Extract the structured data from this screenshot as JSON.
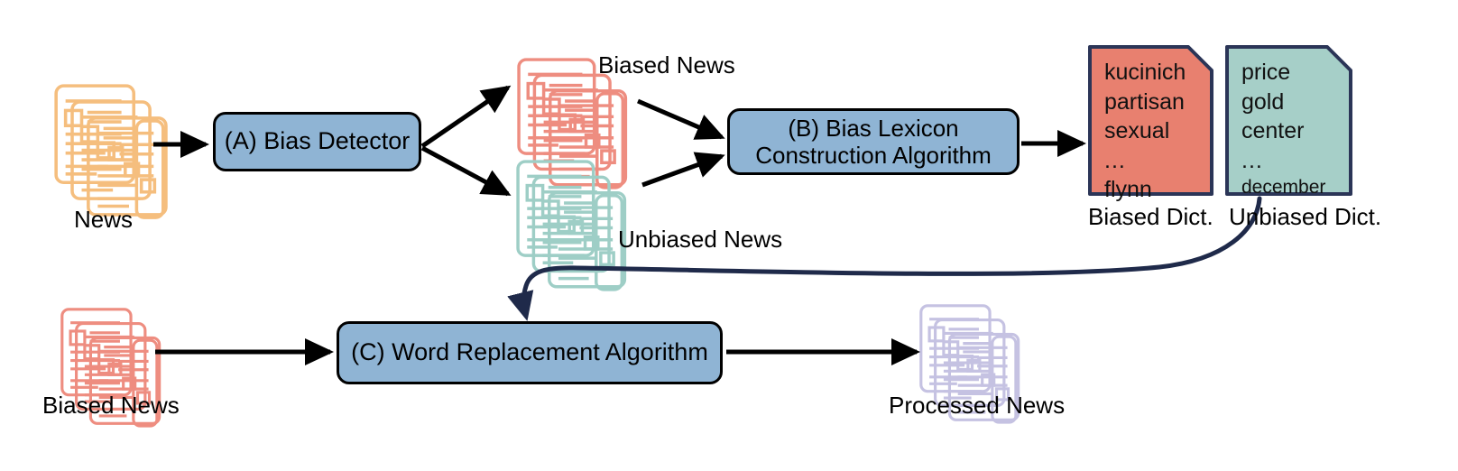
{
  "figure": {
    "type": "pipeline-diagram",
    "background": "#ffffff"
  },
  "palette": {
    "process_box_fill": "#8FB4D4",
    "process_box_stroke": "#000000",
    "news_orange": "#F5BE7E",
    "biased_red": "#EE8D80",
    "unbiased_teal": "#9ECEC6",
    "processed_purple": "#C5C2E2",
    "dict_biased_fill": "#E8806F",
    "dict_unbiased_fill": "#A6CFC8",
    "dict_stroke": "#2B3557",
    "curved_arrow": "#1F2A4A",
    "arrow_black": "#000000"
  },
  "nodes": {
    "news_stack": {
      "label": "News",
      "icon": "document-stack-icon",
      "color": "#F5BE7E"
    },
    "box_a": {
      "label": "(A) Bias Detector"
    },
    "biased_news_stack": {
      "label": "Biased News",
      "icon": "document-stack-icon",
      "color": "#EE8D80"
    },
    "unbiased_news_stack": {
      "label": "Unbiased News",
      "icon": "document-stack-icon",
      "color": "#9ECEC6"
    },
    "box_b": {
      "line1": "(B) Bias Lexicon",
      "line2": "Construction Algorithm"
    },
    "biased_dict": {
      "label": "Biased Dict.",
      "words": [
        "kucinich",
        "partisan",
        "sexual",
        "...",
        "flynn"
      ]
    },
    "unbiased_dict": {
      "label": "Unbiased Dict.",
      "words": [
        "price",
        "gold",
        "center",
        "...",
        "december"
      ]
    },
    "biased_news_stack_2": {
      "label": "Biased News",
      "icon": "document-stack-icon",
      "color": "#EE8D80"
    },
    "box_c": {
      "label": "(C) Word Replacement Algorithm"
    },
    "processed_news_stack": {
      "label": "Processed News",
      "icon": "document-stack-icon",
      "color": "#C5C2E2"
    }
  },
  "edges": [
    {
      "from": "news_stack",
      "to": "box_a",
      "style": "straight-arrow"
    },
    {
      "from": "box_a",
      "to": "biased_news_stack",
      "style": "diagonal-arrow-up"
    },
    {
      "from": "box_a",
      "to": "unbiased_news_stack",
      "style": "diagonal-arrow-down"
    },
    {
      "from": "biased_news_stack",
      "to": "box_b",
      "style": "diagonal-arrow-down"
    },
    {
      "from": "unbiased_news_stack",
      "to": "box_b",
      "style": "diagonal-arrow-up"
    },
    {
      "from": "box_b",
      "to": "biased_dict",
      "style": "straight-arrow"
    },
    {
      "from": "dictionaries",
      "to": "box_c",
      "style": "curved-arrow"
    },
    {
      "from": "biased_news_stack_2",
      "to": "box_c",
      "style": "straight-arrow"
    },
    {
      "from": "box_c",
      "to": "processed_news_stack",
      "style": "straight-arrow"
    }
  ]
}
